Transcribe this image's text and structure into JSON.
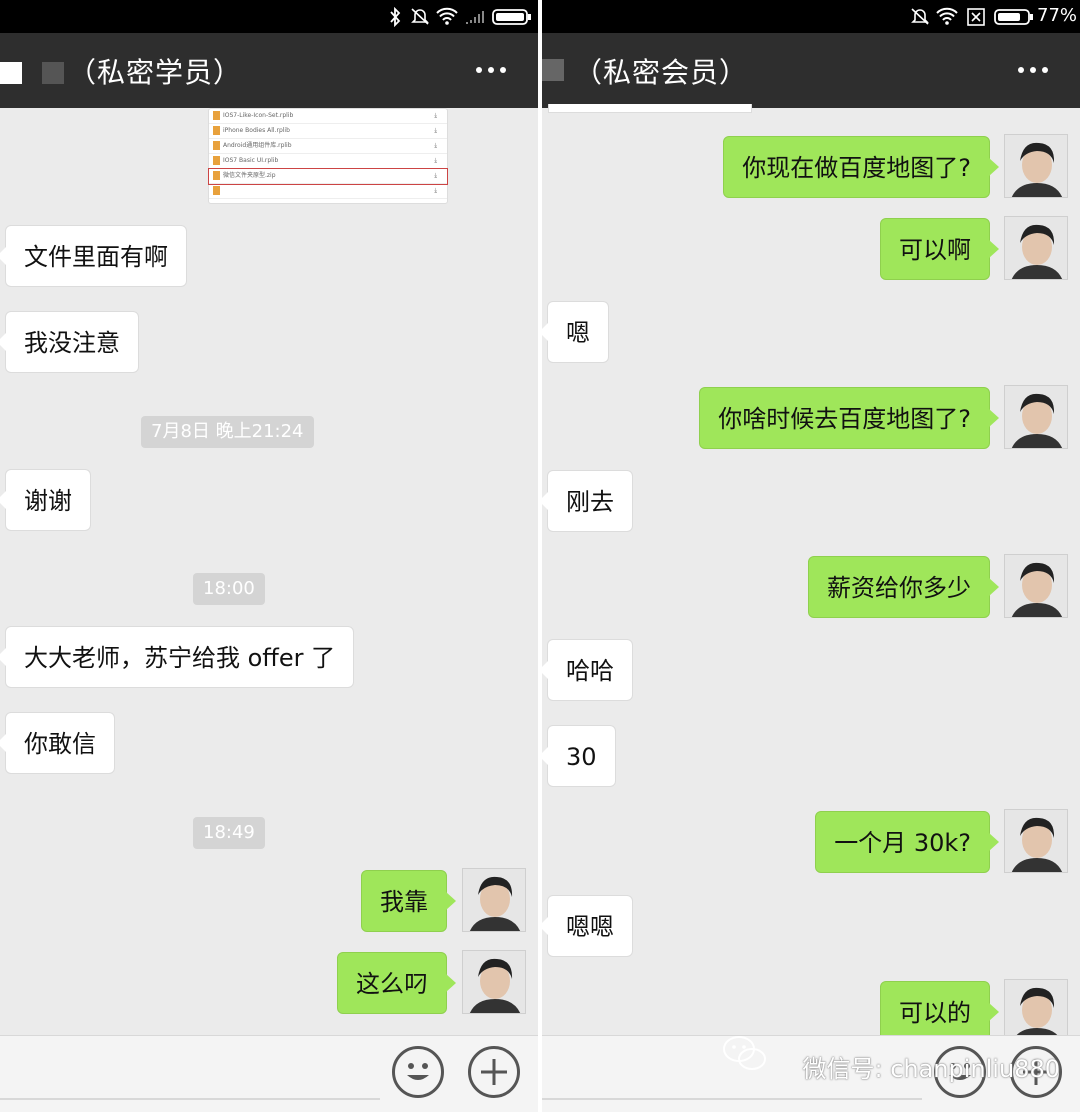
{
  "left": {
    "title": "（私密学员）",
    "attachment_rows": [
      "IOS7-Like-Icon-Set.rplib",
      "iPhone Bodies All.rplib",
      "Android通用组件库.rplib",
      "IOS7 Basic UI.rplib",
      "微信文件夹原型.zip",
      "",
      ""
    ],
    "messages": [
      {
        "text": "文件里面有啊"
      },
      {
        "text": "我没注意"
      },
      {
        "text": "7月8日 晚上21:24"
      },
      {
        "text": "谢谢"
      },
      {
        "text": "18:00"
      },
      {
        "text": "大大老师，苏宁给我 offer 了"
      },
      {
        "text": "你敢信"
      },
      {
        "text": "18:49"
      },
      {
        "text": "我靠"
      },
      {
        "text": "这么叼"
      }
    ]
  },
  "right": {
    "title": "（私密会员）",
    "battery": "77%",
    "messages": [
      {
        "text": "你现在做百度地图了?"
      },
      {
        "text": "可以啊"
      },
      {
        "text": "嗯"
      },
      {
        "text": "你啥时候去百度地图了?"
      },
      {
        "text": "刚去"
      },
      {
        "text": "薪资给你多少"
      },
      {
        "text": "哈哈"
      },
      {
        "text": "30"
      },
      {
        "text": "一个月 30k?"
      },
      {
        "text": "嗯嗯"
      },
      {
        "text": "可以的"
      }
    ]
  },
  "watermark": "微信号: chanpinliu880",
  "icons": [
    "bluetooth-icon",
    "mute-icon",
    "wifi-icon",
    "no-signal-icon",
    "battery-icon",
    "more-icon",
    "emoji-icon",
    "plus-icon",
    "wechat-logo-icon"
  ],
  "colors": {
    "outgoing_bubble": "#9fe65a",
    "incoming_bubble": "#ffffff",
    "titlebar": "#2e2e2e",
    "chat_bg": "#ebebeb"
  }
}
